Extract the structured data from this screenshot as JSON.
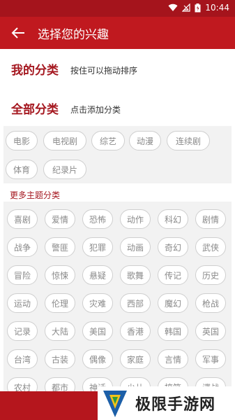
{
  "status_bar": {
    "time": "10:44"
  },
  "app_bar": {
    "title": "选择您的兴趣"
  },
  "my_categories": {
    "heading": "我的分类",
    "hint": "按住可以拖动排序"
  },
  "all_categories": {
    "heading": "全部分类",
    "hint": "点击添加分类",
    "chips": [
      "电影",
      "电视剧",
      "综艺",
      "动漫",
      "连续剧",
      "体育",
      "纪录片"
    ]
  },
  "more_topics": {
    "label": "更多主题分类",
    "rows": [
      [
        "喜剧",
        "爱情",
        "恐怖",
        "动作",
        "科幻",
        "剧情"
      ],
      [
        "战争",
        "警匪",
        "犯罪",
        "动画",
        "奇幻",
        "武侠"
      ],
      [
        "冒险",
        "惊悚",
        "悬疑",
        "歌舞",
        "传记",
        "历史"
      ],
      [
        "运动",
        "伦理",
        "灾难",
        "西部",
        "魔幻",
        "枪战"
      ],
      [
        "记录",
        "大陆",
        "美国",
        "香港",
        "韩国",
        "英国"
      ],
      [
        "台湾",
        "古装",
        "偶像",
        "家庭",
        "言情",
        "军事"
      ],
      [
        "农村",
        "都市",
        "神话",
        "少儿",
        "搞笑",
        "谍战"
      ]
    ]
  },
  "watermark": {
    "text": "极限手游网"
  },
  "colors": {
    "primary": "#c0191f",
    "status": "#a5141c",
    "accent_text": "#a51820",
    "panel_bg": "#f2f2f2"
  }
}
